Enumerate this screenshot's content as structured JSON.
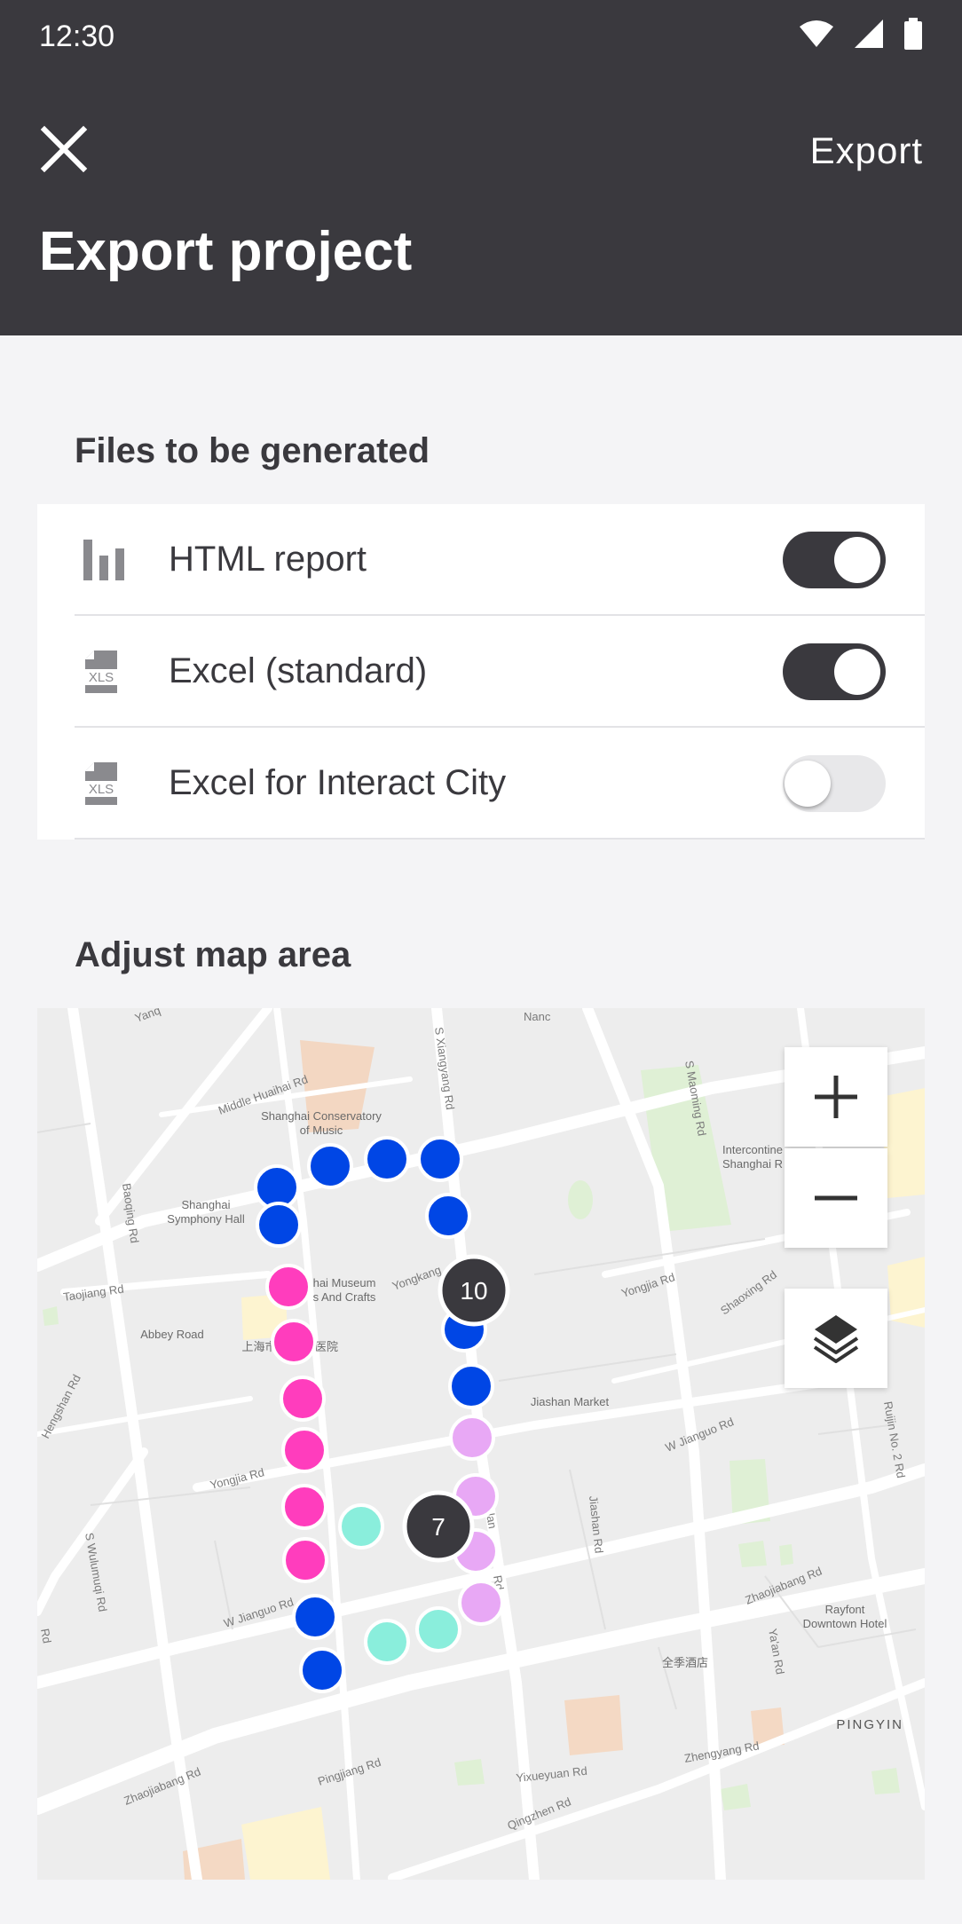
{
  "status_bar": {
    "time": "12:30"
  },
  "app_bar": {
    "title": "Export project",
    "action_label": "Export"
  },
  "files_section": {
    "title": "Files to be generated",
    "items": [
      {
        "label": "HTML report",
        "icon": "bar-chart-icon",
        "enabled": true
      },
      {
        "label": "Excel (standard)",
        "icon": "xls-file-icon",
        "enabled": true
      },
      {
        "label": "Excel for Interact City",
        "icon": "xls-file-icon",
        "enabled": false
      }
    ]
  },
  "map_section": {
    "title": "Adjust map area",
    "clusters": [
      "10",
      "7"
    ],
    "labels": {
      "conservatory": "Shanghai Conservatory",
      "conservatory2": "of Music",
      "symphony": "Shanghai",
      "symphony2": "Symphony Hall",
      "museum": "hai Museum",
      "museum2": "s And Crafts",
      "abbey": "Abbey Road",
      "hospital": "上海市",
      "hospital2": "医院",
      "jiashan": "Jiashan Market",
      "intercont": "Intercontine",
      "intercont2": "Shanghai R",
      "rayfont": "Rayfont",
      "rayfont2": "Downtown Hotel",
      "quanji": "全季酒店",
      "pingyin": "PINGYIN",
      "middle_huaihai": "Middle Huaihai Rd",
      "xiangyang": "S Xiangyang Rd",
      "maoming": "S Maoming Rd",
      "baoqing": "Baoqing Rd",
      "taojiang": "Taojiang Rd",
      "yongkang": "Yongkang",
      "yongjia": "Yongjia Rd",
      "yongjia2": "Yongjia Rd",
      "shaoxing": "Shaoxing Rd",
      "hengshan": "Hengshan Rd",
      "wulumuqi": "S Wulumuqi Rd",
      "wjianguo": "W Jianguo Rd",
      "wjianguo2": "W Jianguo Rd",
      "jiashan_rd": "Jiashan Rd",
      "ruijin": "Ruijin No. 2 Rd",
      "zhaojiabang": "Zhaojiabang Rd",
      "zhaojiabang2": "Zhaojiabang Rd",
      "yaan": "Ya'an Rd",
      "zhengyang": "Zhengyang Rd",
      "yixueyuan": "Yixueyuan Rd",
      "qingzhen": "Qingzhen Rd",
      "pingjiang": "Pingjiang Rd",
      "nanchang": "Nanc",
      "yanq": "Yanq",
      "rd_left": "Rd",
      "lan": "lan",
      "rd_mid": "Rd"
    }
  },
  "colors": {
    "app_bar": "#3a393e",
    "marker_blue": "#0046e5",
    "marker_pink": "#ff3dbd",
    "marker_lavender": "#e8a8f5",
    "marker_teal": "#8aeedc",
    "cluster": "#3a393e"
  }
}
